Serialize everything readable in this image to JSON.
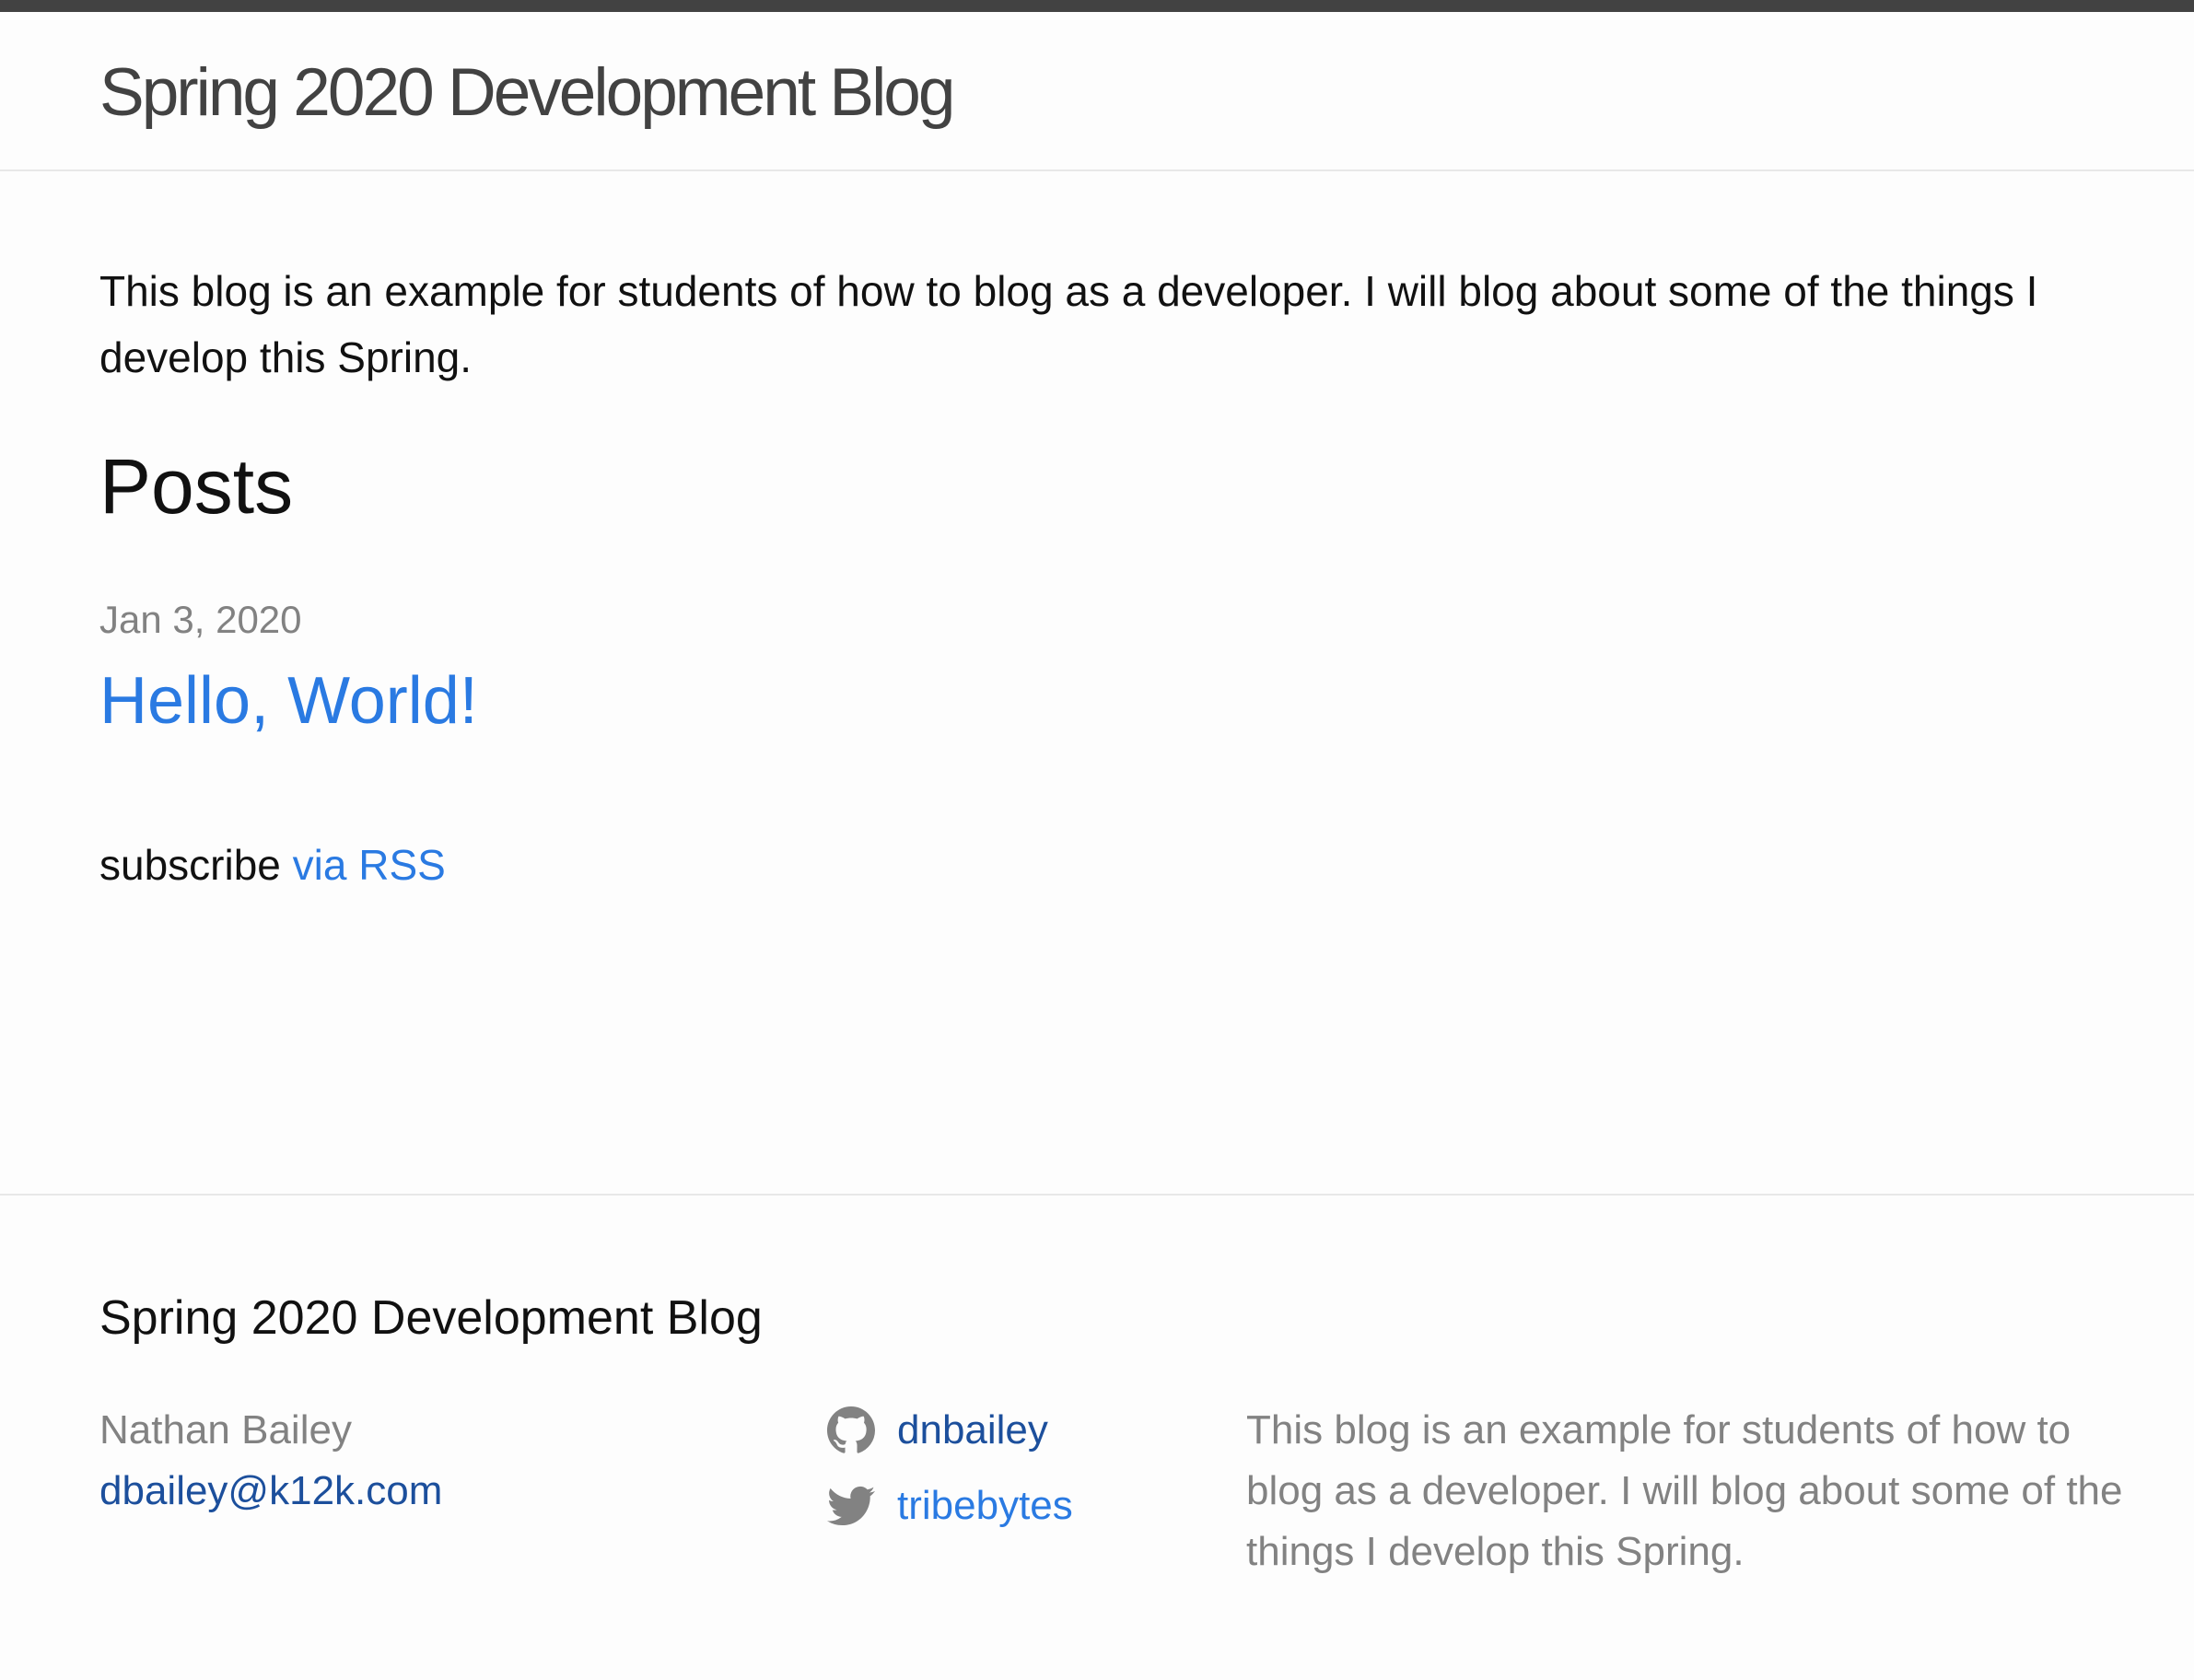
{
  "site": {
    "title": "Spring 2020 Development Blog"
  },
  "main": {
    "intro": "This blog is an example for students of how to blog as a developer. I will blog about some of the things I develop this Spring.",
    "posts_heading": "Posts",
    "posts": [
      {
        "date": "Jan 3, 2020",
        "title": "Hello, World!"
      }
    ],
    "subscribe_text": "subscribe",
    "subscribe_link": "via RSS"
  },
  "footer": {
    "heading": "Spring 2020 Development Blog",
    "author_name": "Nathan Bailey",
    "email": "dbailey@k12k.com",
    "social": [
      {
        "icon": "github-icon",
        "username": "dnbailey"
      },
      {
        "icon": "twitter-icon",
        "username": "tribebytes"
      }
    ],
    "description": "This blog is an example for students of how to blog as a developer. I will blog about some of the things I develop this Spring."
  },
  "colors": {
    "top_bar": "#424242",
    "title_text": "#424242",
    "body_text": "#111111",
    "muted_text": "#828282",
    "link": "#2a7ae2",
    "link_dark": "#1c4f9c",
    "divider": "#e8e8e8",
    "background": "#fdfdfd"
  }
}
